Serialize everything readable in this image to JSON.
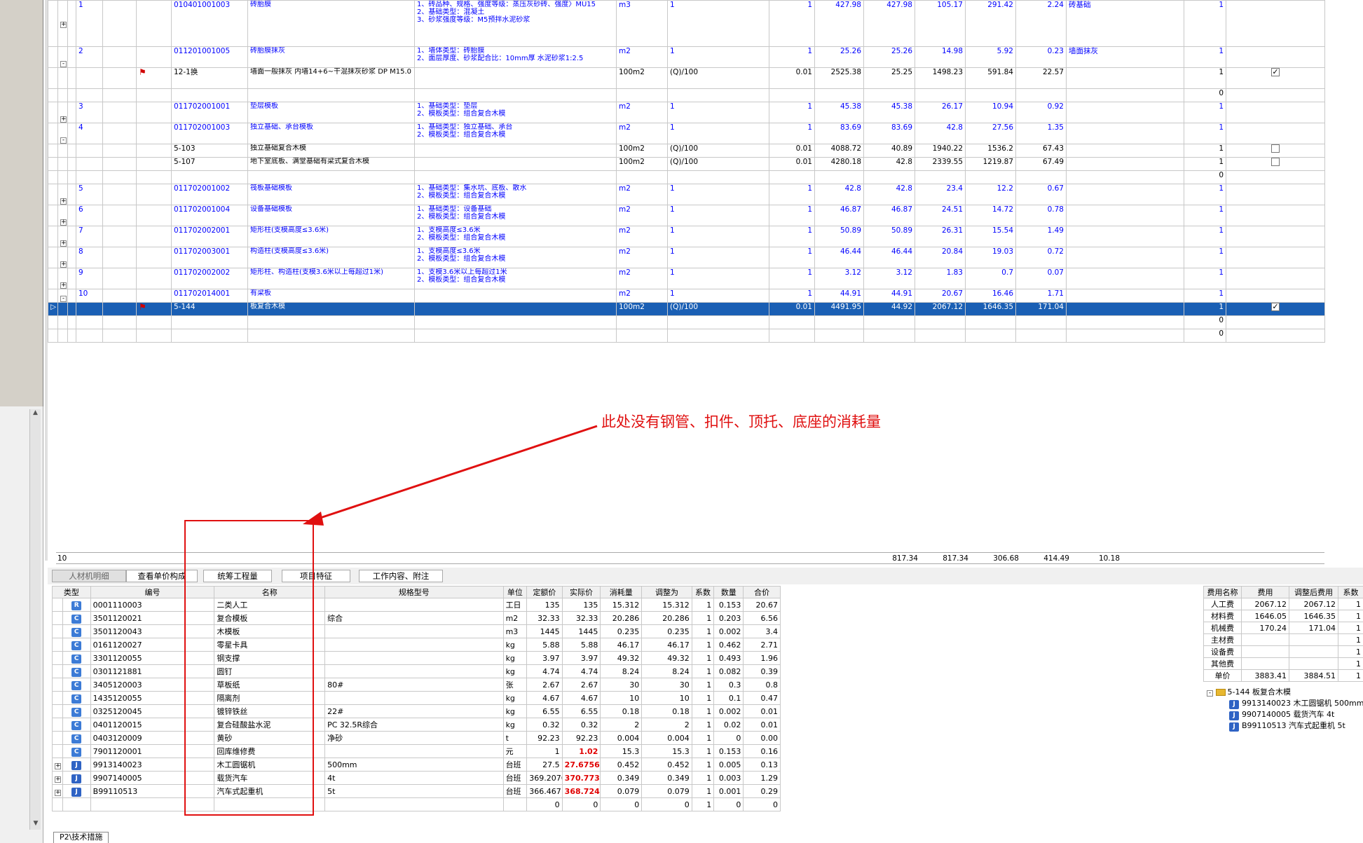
{
  "main_rows": [
    {
      "kind": "q",
      "no": "1",
      "code": "010401001003",
      "name": "砖胎膜",
      "feature": "1、砖品种、规格、强度等级：蒸压灰砂砖、强度〉MU15\n2、基础类型：混凝土\n3、砂浆强度等级：M5预拌水泥砂浆",
      "unit": "m3",
      "qty": "1",
      "c1": "1",
      "c2": "427.98",
      "c3": "427.98",
      "c4": "105.17",
      "c5": "291.42",
      "c6": "2.24",
      "pro": "砖基础",
      "c7": "1",
      "tw": "+",
      "h": 66
    },
    {
      "kind": "q",
      "no": "2",
      "code": "011201001005",
      "name": "砖胎膜抹灰",
      "feature": "1、墙体类型：砖胎膜\n2、面层厚度、砂浆配合比：10mm厚 水泥砂浆1:2.5",
      "unit": "m2",
      "qty": "1",
      "c1": "1",
      "c2": "25.26",
      "c3": "25.26",
      "c4": "14.98",
      "c5": "5.92",
      "c6": "0.23",
      "pro": "墙面抹灰",
      "c7": "1",
      "tw": "-",
      "h": 30
    },
    {
      "kind": "d",
      "flag": "1",
      "code": "12-1换",
      "name": "墙面一般抹灰 内墙14+6~干混抹灰砂浆 DP M15.0",
      "unit": "100m2",
      "qty": "(Q)/100",
      "c1": "0.01",
      "c2": "2525.38",
      "c3": "25.25",
      "c4": "1498.23",
      "c5": "591.84",
      "c6": "22.57",
      "c7": "1",
      "cb": "checked",
      "h": 30
    },
    {
      "kind": "e",
      "c7": "0",
      "h": 19
    },
    {
      "kind": "q",
      "no": "3",
      "code": "011702001001",
      "name": "垫层模板",
      "feature": "1、基础类型：垫层\n2、模板类型：组合复合木模",
      "unit": "m2",
      "qty": "1",
      "c1": "1",
      "c2": "45.38",
      "c3": "45.38",
      "c4": "26.17",
      "c5": "10.94",
      "c6": "0.92",
      "c7": "1",
      "tw": "+",
      "h": 30
    },
    {
      "kind": "q",
      "no": "4",
      "code": "011702001003",
      "name": "独立基础、承台模板",
      "feature": "1、基础类型：独立基础、承台\n2、模板类型：组合复合木模",
      "unit": "m2",
      "qty": "1",
      "c1": "1",
      "c2": "83.69",
      "c3": "83.69",
      "c4": "42.8",
      "c5": "27.56",
      "c6": "1.35",
      "c7": "1",
      "tw": "-",
      "h": 30
    },
    {
      "kind": "d",
      "code": "5-103",
      "name": "独立基础复合木模",
      "unit": "100m2",
      "qty": "(Q)/100",
      "c1": "0.01",
      "c2": "4088.72",
      "c3": "40.89",
      "c4": "1940.22",
      "c5": "1536.2",
      "c6": "67.43",
      "c7": "1",
      "cb": "unchecked",
      "h": 19
    },
    {
      "kind": "d",
      "code": "5-107",
      "name": "地下室底板、满堂基础有梁式复合木模",
      "unit": "100m2",
      "qty": "(Q)/100",
      "c1": "0.01",
      "c2": "4280.18",
      "c3": "42.8",
      "c4": "2339.55",
      "c5": "1219.87",
      "c6": "67.49",
      "c7": "1",
      "cb": "unchecked",
      "h": 19
    },
    {
      "kind": "e",
      "c7": "0",
      "h": 19
    },
    {
      "kind": "q",
      "no": "5",
      "code": "011702001002",
      "name": "筏板基础模板",
      "feature": "1、基础类型：集水坑、底板、散水\n2、模板类型：组合复合木模",
      "unit": "m2",
      "qty": "1",
      "c1": "1",
      "c2": "42.8",
      "c3": "42.8",
      "c4": "23.4",
      "c5": "12.2",
      "c6": "0.67",
      "c7": "1",
      "tw": "+",
      "h": 30
    },
    {
      "kind": "q",
      "no": "6",
      "code": "011702001004",
      "name": "设备基础模板",
      "feature": "1、基础类型：设备基础\n2、模板类型：组合复合木模",
      "unit": "m2",
      "qty": "1",
      "c1": "1",
      "c2": "46.87",
      "c3": "46.87",
      "c4": "24.51",
      "c5": "14.72",
      "c6": "0.78",
      "c7": "1",
      "tw": "+",
      "h": 30
    },
    {
      "kind": "q",
      "no": "7",
      "code": "011702002001",
      "name": "矩形柱(支模高度≤3.6米)",
      "feature": "1、支模高度≤3.6米\n2、模板类型：组合复合木模",
      "unit": "m2",
      "qty": "1",
      "c1": "1",
      "c2": "50.89",
      "c3": "50.89",
      "c4": "26.31",
      "c5": "15.54",
      "c6": "1.49",
      "c7": "1",
      "tw": "+",
      "h": 30
    },
    {
      "kind": "q",
      "no": "8",
      "code": "011702003001",
      "name": "构造柱(支模高度≤3.6米)",
      "feature": "1、支模高度≤3.6米\n2、模板类型：组合复合木模",
      "unit": "m2",
      "qty": "1",
      "c1": "1",
      "c2": "46.44",
      "c3": "46.44",
      "c4": "20.84",
      "c5": "19.03",
      "c6": "0.72",
      "c7": "1",
      "tw": "+",
      "h": 30
    },
    {
      "kind": "q",
      "no": "9",
      "code": "011702002002",
      "name": "矩形柱、构造柱(支模3.6米以上每超过1米)",
      "feature": "1、支模3.6米以上每超过1米\n2、模板类型：组合复合木模",
      "unit": "m2",
      "qty": "1",
      "c1": "1",
      "c2": "3.12",
      "c3": "3.12",
      "c4": "1.83",
      "c5": "0.7",
      "c6": "0.07",
      "c7": "1",
      "tw": "+",
      "h": 30
    },
    {
      "kind": "q",
      "no": "10",
      "code": "011702014001",
      "name": "有梁板",
      "feature": "",
      "unit": "m2",
      "qty": "1",
      "c1": "1",
      "c2": "44.91",
      "c3": "44.91",
      "c4": "20.67",
      "c5": "16.46",
      "c6": "1.71",
      "c7": "1",
      "tw": "-",
      "h": 19
    },
    {
      "kind": "sel",
      "flag": "1",
      "code": "5-144",
      "name": "板复合木模",
      "unit": "100m2",
      "qty": "(Q)/100",
      "c1": "0.01",
      "c2": "4491.95",
      "c3": "44.92",
      "c4": "2067.12",
      "c5": "1646.35",
      "c6": "171.04",
      "c7": "1",
      "cb": "checked",
      "h": 19
    },
    {
      "kind": "e",
      "c7": "0",
      "h": 19
    },
    {
      "kind": "e",
      "c7": "0",
      "h": 19
    }
  ],
  "summary": {
    "no": "10",
    "v1": "817.34",
    "v2": "817.34",
    "v3": "306.68",
    "v4": "414.49",
    "v5": "10.18"
  },
  "tabs": [
    "人材机明细",
    "查看单价构成",
    "统筹工程量",
    "项目特征",
    "工作内容、附注"
  ],
  "annotation": "此处没有钢管、扣件、顶托、底座的消耗量",
  "bottom_headers": [
    "类型",
    "编号",
    "名称",
    "规格型号",
    "单位",
    "定额价",
    "实际价",
    "消耗量",
    "调整为",
    "系数",
    "数量",
    "合价"
  ],
  "bottom_rows": [
    {
      "type": "R",
      "code": "0001110003",
      "name": "二类人工",
      "spec": "",
      "unit": "工日",
      "p1": "135",
      "p2": "135",
      "r2": "0",
      "cons": "15.312",
      "adj": "15.312",
      "coef": "1",
      "qty": "0.153",
      "total": "20.67"
    },
    {
      "type": "C",
      "code": "3501120021",
      "name": "复合模板",
      "spec": "综合",
      "unit": "m2",
      "p1": "32.33",
      "p2": "32.33",
      "r2": "0",
      "cons": "20.286",
      "adj": "20.286",
      "coef": "1",
      "qty": "0.203",
      "total": "6.56"
    },
    {
      "type": "C",
      "code": "3501120043",
      "name": "木模板",
      "spec": "",
      "unit": "m3",
      "p1": "1445",
      "p2": "1445",
      "r2": "0",
      "cons": "0.235",
      "adj": "0.235",
      "coef": "1",
      "qty": "0.002",
      "total": "3.4"
    },
    {
      "type": "C",
      "code": "0161120027",
      "name": "零星卡具",
      "spec": "",
      "unit": "kg",
      "p1": "5.88",
      "p2": "5.88",
      "r2": "0",
      "cons": "46.17",
      "adj": "46.17",
      "coef": "1",
      "qty": "0.462",
      "total": "2.71"
    },
    {
      "type": "C",
      "code": "3301120055",
      "name": "钢支撑",
      "spec": "",
      "unit": "kg",
      "p1": "3.97",
      "p2": "3.97",
      "r2": "0",
      "cons": "49.32",
      "adj": "49.32",
      "coef": "1",
      "qty": "0.493",
      "total": "1.96"
    },
    {
      "type": "C",
      "code": "0301121881",
      "name": "圆钉",
      "spec": "",
      "unit": "kg",
      "p1": "4.74",
      "p2": "4.74",
      "r2": "0",
      "cons": "8.24",
      "adj": "8.24",
      "coef": "1",
      "qty": "0.082",
      "total": "0.39"
    },
    {
      "type": "C",
      "code": "3405120003",
      "name": "草板纸",
      "spec": "80#",
      "unit": "张",
      "p1": "2.67",
      "p2": "2.67",
      "r2": "0",
      "cons": "30",
      "adj": "30",
      "coef": "1",
      "qty": "0.3",
      "total": "0.8"
    },
    {
      "type": "C",
      "code": "1435120055",
      "name": "隔离剂",
      "spec": "",
      "unit": "kg",
      "p1": "4.67",
      "p2": "4.67",
      "r2": "0",
      "cons": "10",
      "adj": "10",
      "coef": "1",
      "qty": "0.1",
      "total": "0.47"
    },
    {
      "type": "C",
      "code": "0325120045",
      "name": "镀锌铁丝",
      "spec": "22#",
      "unit": "kg",
      "p1": "6.55",
      "p2": "6.55",
      "r2": "0",
      "cons": "0.18",
      "adj": "0.18",
      "coef": "1",
      "qty": "0.002",
      "total": "0.01"
    },
    {
      "type": "C",
      "code": "0401120015",
      "name": "复合硅酸盐水泥",
      "spec": "PC 32.5R综合",
      "unit": "kg",
      "p1": "0.32",
      "p2": "0.32",
      "r2": "0",
      "cons": "2",
      "adj": "2",
      "coef": "1",
      "qty": "0.02",
      "total": "0.01"
    },
    {
      "type": "C",
      "code": "0403120009",
      "name": "黄砂",
      "spec": "净砂",
      "unit": "t",
      "p1": "92.23",
      "p2": "92.23",
      "r2": "0",
      "cons": "0.004",
      "adj": "0.004",
      "coef": "1",
      "qty": "0",
      "total": "0.00"
    },
    {
      "type": "C",
      "code": "7901120001",
      "name": "回库维修费",
      "spec": "",
      "unit": "元",
      "p1": "1",
      "p2": "1.02",
      "r2": "1",
      "cons": "15.3",
      "adj": "15.3",
      "coef": "1",
      "qty": "0.153",
      "total": "0.16"
    },
    {
      "type": "J",
      "code": "9913140023",
      "name": "木工圆锯机",
      "spec": "500mm",
      "unit": "台班",
      "p1": "27.5",
      "p2": "27.6756",
      "r2": "1",
      "cons": "0.452",
      "adj": "0.452",
      "coef": "1",
      "qty": "0.005",
      "total": "0.13"
    },
    {
      "type": "J",
      "code": "9907140005",
      "name": "载货汽车",
      "spec": "4t",
      "unit": "台班",
      "p1": "369.2076",
      "p2": "370.773",
      "r2": "1",
      "cons": "0.349",
      "adj": "0.349",
      "coef": "1",
      "qty": "0.003",
      "total": "1.29"
    },
    {
      "type": "J",
      "code": "B99110513",
      "name": "汽车式起重机",
      "spec": "5t",
      "unit": "台班",
      "p1": "366.467",
      "p2": "368.724",
      "r2": "1",
      "cons": "0.079",
      "adj": "0.079",
      "coef": "1",
      "qty": "0.001",
      "total": "0.29"
    }
  ],
  "bottom_total": {
    "p1": "0",
    "p2": "0",
    "cons": "0",
    "adj": "0",
    "coef": "1",
    "qty": "0",
    "total": "0"
  },
  "fee_headers": [
    "费用名称",
    "费用",
    "调整后费用",
    "系数"
  ],
  "fee_rows": [
    {
      "name": "人工费",
      "fee": "2067.12",
      "adj": "2067.12",
      "coef": "1"
    },
    {
      "name": "材料费",
      "fee": "1646.05",
      "adj": "1646.35",
      "coef": "1"
    },
    {
      "name": "机械费",
      "fee": "170.24",
      "adj": "171.04",
      "coef": "1"
    },
    {
      "name": "主材费",
      "fee": "",
      "adj": "",
      "coef": "1"
    },
    {
      "name": "设备费",
      "fee": "",
      "adj": "",
      "coef": "1"
    },
    {
      "name": "其他费",
      "fee": "",
      "adj": "",
      "coef": "1"
    },
    {
      "name": "单价",
      "fee": "3883.41",
      "adj": "3884.51",
      "coef": "1"
    }
  ],
  "tree": {
    "root": "5-144 板复合木模",
    "children": [
      "9913140023 木工圆锯机 500mm",
      "9907140005 载货汽车 4t",
      "B99110513 汽车式起重机 5t"
    ]
  },
  "bottom_tab": "P2\\技术措施",
  "colors": {
    "quota_blue": "#0000ff",
    "selected": "#1a5fb4",
    "annotation_red": "#e01010"
  }
}
